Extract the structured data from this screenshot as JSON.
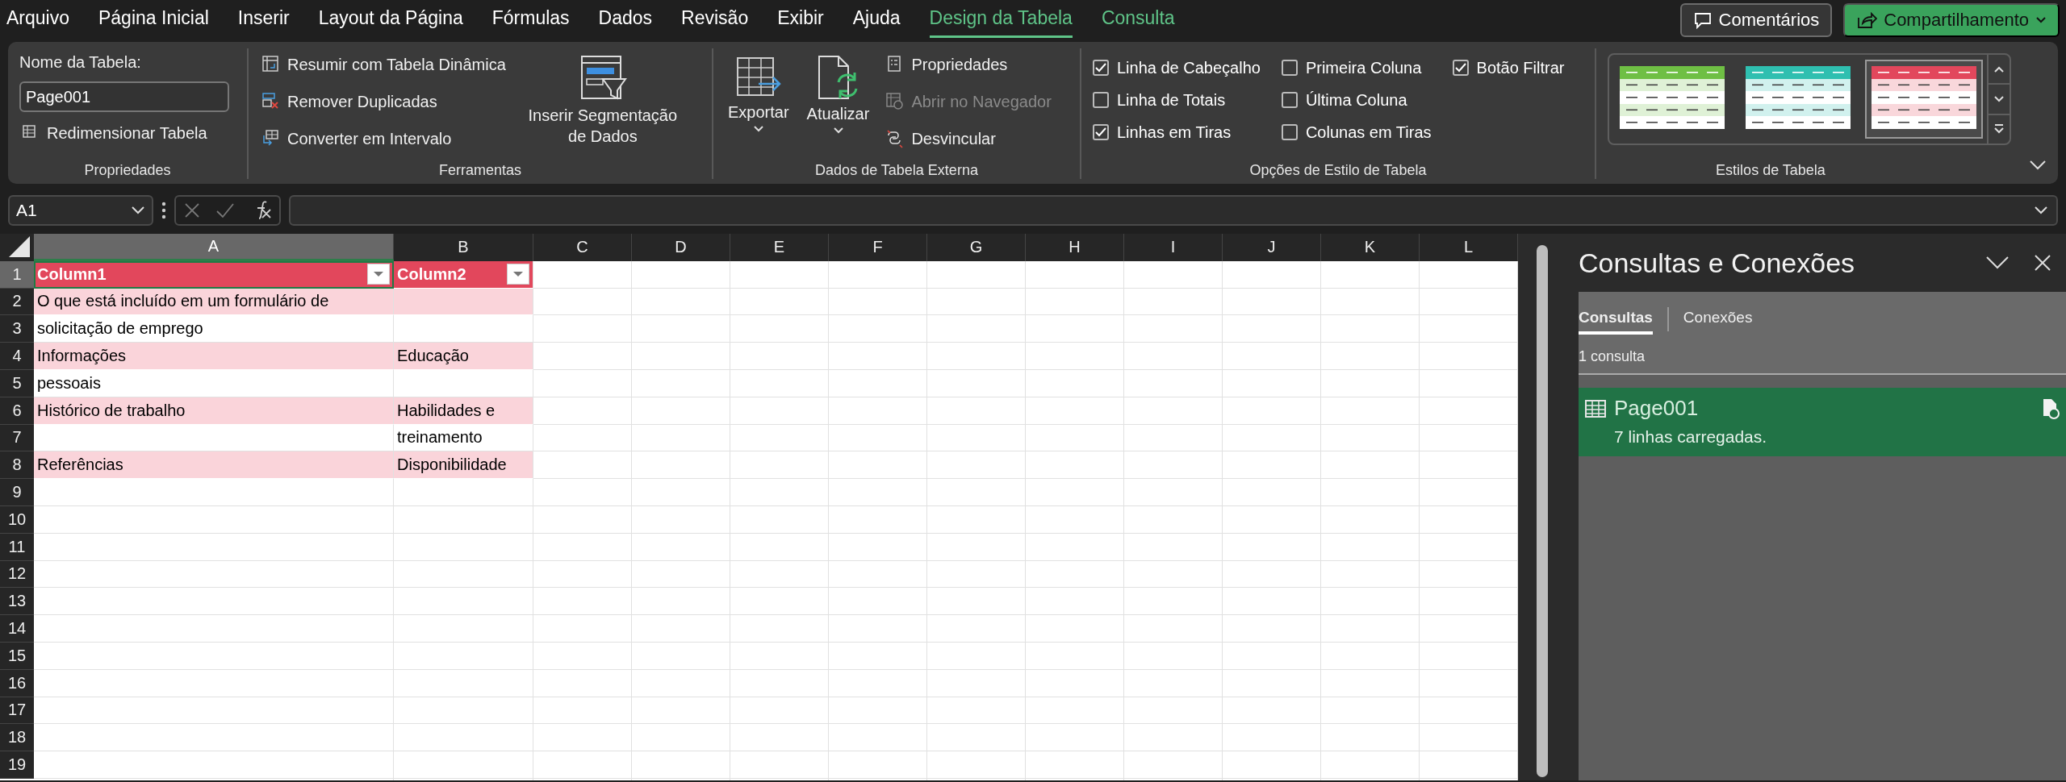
{
  "menu_tabs": [
    {
      "label": "Arquivo",
      "selected": false,
      "kind": "standard"
    },
    {
      "label": "Página Inicial",
      "selected": false,
      "kind": "standard"
    },
    {
      "label": "Inserir",
      "selected": false,
      "kind": "standard"
    },
    {
      "label": "Layout da Página",
      "selected": false,
      "kind": "standard"
    },
    {
      "label": "Fórmulas",
      "selected": false,
      "kind": "standard"
    },
    {
      "label": "Dados",
      "selected": false,
      "kind": "standard"
    },
    {
      "label": "Revisão",
      "selected": false,
      "kind": "standard"
    },
    {
      "label": "Exibir",
      "selected": false,
      "kind": "standard"
    },
    {
      "label": "Ajuda",
      "selected": false,
      "kind": "standard"
    },
    {
      "label": "Design da Tabela",
      "selected": true,
      "kind": "contextual"
    },
    {
      "label": "Consulta",
      "selected": false,
      "kind": "contextual"
    }
  ],
  "header_buttons": [
    {
      "kind": "comments",
      "label": "Comentários"
    },
    {
      "kind": "share",
      "label": "Compartilhamento"
    }
  ],
  "ribbon": {
    "groups": [
      {
        "kind": "properties",
        "label": "Propriedades",
        "name_label": "Nome da Tabela:",
        "name_value": "Page001",
        "commands": [
          {
            "label": "Redimensionar Tabela",
            "disabled": false
          }
        ]
      },
      {
        "kind": "tools",
        "label": "Ferramentas",
        "commands": [
          {
            "label": "Resumir com Tabela Dinâmica",
            "disabled": false
          },
          {
            "label": "Remover Duplicadas",
            "disabled": false
          },
          {
            "label": "Converter em Intervalo",
            "disabled": false
          }
        ],
        "big_buttons": [
          {
            "label": "Inserir Segmentação de Dados",
            "dropdown": false
          }
        ]
      },
      {
        "kind": "external",
        "label": "Dados de Tabela Externa",
        "big_buttons": [
          {
            "label": "Exportar",
            "dropdown": true
          },
          {
            "label": "Atualizar",
            "dropdown": true
          }
        ],
        "commands": [
          {
            "label": "Propriedades",
            "disabled": false
          },
          {
            "label": "Abrir no Navegador",
            "disabled": true
          },
          {
            "label": "Desvincular",
            "disabled": false
          }
        ]
      },
      {
        "kind": "style_options",
        "label": "Opções de Estilo de Tabela",
        "checkboxes": [
          {
            "label": "Linha de Cabeçalho",
            "checked": true
          },
          {
            "label": "Linha de Totais",
            "checked": false
          },
          {
            "label": "Linhas em Tiras",
            "checked": true
          },
          {
            "label": "Primeira Coluna",
            "checked": false
          },
          {
            "label": "Última Coluna",
            "checked": false
          },
          {
            "label": "Colunas em Tiras",
            "checked": false
          },
          {
            "label": "Botão Filtrar",
            "checked": true
          }
        ]
      },
      {
        "kind": "styles",
        "label": "Estilos de Tabela",
        "styles": [
          {
            "color": "#6fbf44",
            "selected": false
          },
          {
            "color": "#2fbfb0",
            "selected": false
          },
          {
            "color": "#e2475c",
            "selected": true
          }
        ]
      }
    ]
  },
  "formula_bar": {
    "name_box": "A1"
  },
  "sheet": {
    "columns": [
      {
        "label": "A",
        "selected": true
      },
      {
        "label": "B",
        "selected": false
      },
      {
        "label": "C",
        "selected": false
      },
      {
        "label": "D",
        "selected": false
      },
      {
        "label": "E",
        "selected": false
      },
      {
        "label": "F",
        "selected": false
      },
      {
        "label": "G",
        "selected": false
      },
      {
        "label": "H",
        "selected": false
      },
      {
        "label": "I",
        "selected": false
      },
      {
        "label": "J",
        "selected": false
      },
      {
        "label": "K",
        "selected": false
      },
      {
        "label": "L",
        "selected": false
      }
    ],
    "rows": [
      {
        "number": "1",
        "selected": true,
        "kind": "header",
        "cells": [
          "Column1",
          "Column2"
        ]
      },
      {
        "number": "2",
        "selected": false,
        "kind": "band",
        "cells": [
          "O que está incluído em um formulário de",
          null
        ]
      },
      {
        "number": "3",
        "selected": false,
        "kind": "plain",
        "cells": [
          "solicitação de emprego",
          null
        ]
      },
      {
        "number": "4",
        "selected": false,
        "kind": "band",
        "cells": [
          "Informações",
          "Educação"
        ]
      },
      {
        "number": "5",
        "selected": false,
        "kind": "plain",
        "cells": [
          "pessoais",
          null
        ]
      },
      {
        "number": "6",
        "selected": false,
        "kind": "band",
        "cells": [
          "Histórico de trabalho",
          "Habilidades e"
        ]
      },
      {
        "number": "7",
        "selected": false,
        "kind": "plain",
        "cells": [
          null,
          "treinamento"
        ]
      },
      {
        "number": "8",
        "selected": false,
        "kind": "band",
        "cells": [
          "Referências",
          "Disponibilidade"
        ]
      },
      {
        "number": "9",
        "selected": false,
        "kind": "empty"
      },
      {
        "number": "10",
        "selected": false,
        "kind": "empty"
      },
      {
        "number": "11",
        "selected": false,
        "kind": "empty"
      },
      {
        "number": "12",
        "selected": false,
        "kind": "empty"
      },
      {
        "number": "13",
        "selected": false,
        "kind": "empty"
      },
      {
        "number": "14",
        "selected": false,
        "kind": "empty"
      },
      {
        "number": "15",
        "selected": false,
        "kind": "empty"
      },
      {
        "number": "16",
        "selected": false,
        "kind": "empty"
      },
      {
        "number": "17",
        "selected": false,
        "kind": "empty"
      },
      {
        "number": "18",
        "selected": false,
        "kind": "empty"
      },
      {
        "number": "19",
        "selected": false,
        "kind": "empty"
      }
    ]
  },
  "queries_pane": {
    "title": "Consultas e Conexões",
    "tabs": [
      {
        "label": "Consultas",
        "selected": true
      },
      {
        "label": "Conexões",
        "selected": false
      }
    ],
    "count": "1 consulta",
    "queries": [
      {
        "name": "Page001",
        "status": "7 linhas carregadas.",
        "selected": true
      }
    ]
  }
}
